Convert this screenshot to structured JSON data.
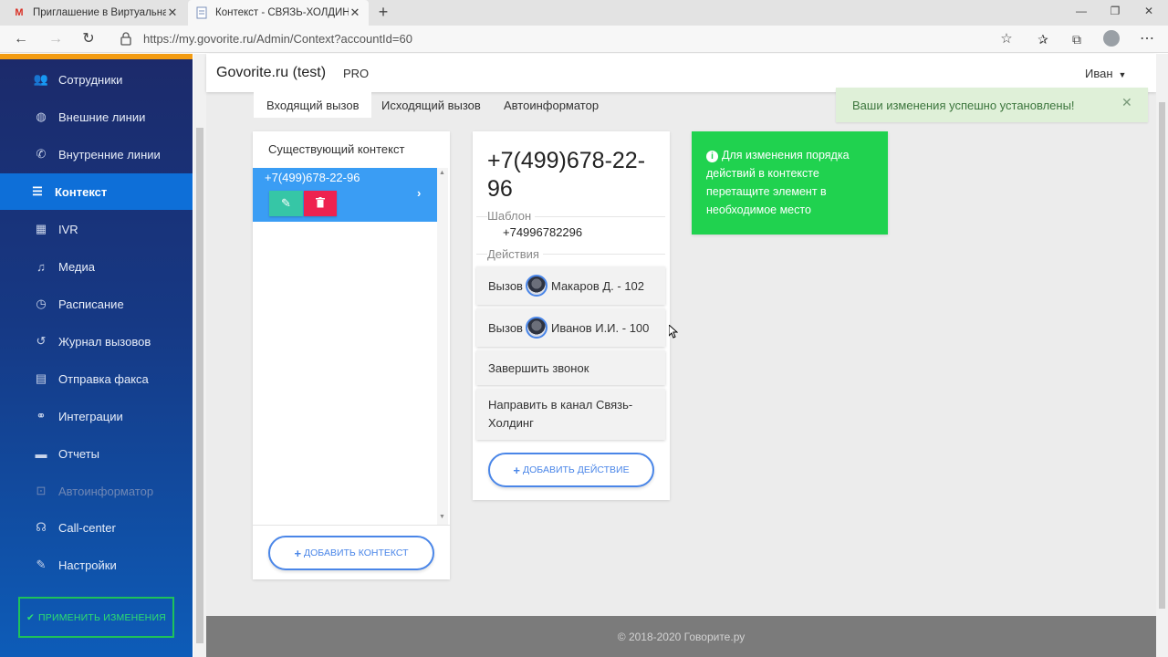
{
  "browser": {
    "tabs": [
      {
        "title": "Приглашение в Виртуальная АТ",
        "icon": "gmail-icon"
      },
      {
        "title": "Контекст - СВЯЗЬ-ХОЛДИНГ",
        "icon": "page-icon"
      }
    ],
    "url": "https://my.govorite.ru/Admin/Context?accountId=60"
  },
  "sidebar": {
    "items": [
      {
        "label": "Сотрудники",
        "icon": "users-icon"
      },
      {
        "label": "Внешние линии",
        "icon": "globe-icon"
      },
      {
        "label": "Внутренние линии",
        "icon": "phone-icon"
      },
      {
        "label": "Контекст",
        "icon": "list-icon"
      },
      {
        "label": "IVR",
        "icon": "grid-icon"
      },
      {
        "label": "Медиа",
        "icon": "music-icon"
      },
      {
        "label": "Расписание",
        "icon": "clock-icon"
      },
      {
        "label": "Журнал вызовов",
        "icon": "history-icon"
      },
      {
        "label": "Отправка факса",
        "icon": "fax-icon"
      },
      {
        "label": "Интеграции",
        "icon": "handshake-icon"
      },
      {
        "label": "Отчеты",
        "icon": "report-icon"
      },
      {
        "label": "Автоинформатор",
        "icon": "robot-icon"
      },
      {
        "label": "Call-center",
        "icon": "headset-icon"
      },
      {
        "label": "Настройки",
        "icon": "wrench-icon"
      }
    ],
    "active_index": 3,
    "apply_button": "ПРИМЕНИТЬ ИЗМЕНЕНИЯ"
  },
  "header": {
    "brand": "Govorite.ru (test)",
    "plan": "PRO",
    "user": "Иван"
  },
  "tabs": [
    "Входящий вызов",
    "Исходящий вызов",
    "Автоинформатор"
  ],
  "toast": "Ваши изменения успешно установлены!",
  "context_list": {
    "title": "Существующий контекст",
    "selected": "+7(499)678-22-96",
    "add_button": "ДОБАВИТЬ КОНТЕКСТ"
  },
  "detail": {
    "phone": "+7(499)678-22-96",
    "template_label": "Шаблон",
    "template_value": "+74996782296",
    "actions_label": "Действия",
    "actions": [
      {
        "verb": "Вызов",
        "target": "Макаров Д. - 102"
      },
      {
        "verb": "Вызов",
        "target": "Иванов И.И. - 100"
      },
      {
        "verb": "Завершить звонок",
        "target": ""
      },
      {
        "verb": "Направить в канал Связь-Холдинг",
        "target": ""
      }
    ],
    "add_button": "ДОБАВИТЬ ДЕЙСТВИЕ"
  },
  "hint": "Для изменения порядка действий в контексте перетащите элемент в необходимое место",
  "footer": "© 2018-2020 Говорите.ру",
  "colors": {
    "accent": "#4a86e8",
    "sidebar_active": "#0e6fd8",
    "hint_bg": "#20d24f",
    "delete": "#ee2250",
    "edit": "#36c6a6"
  }
}
